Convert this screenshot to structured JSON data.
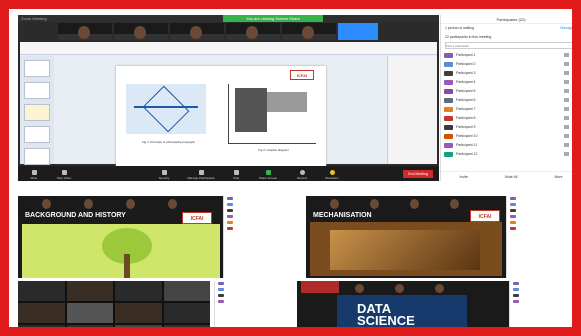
{
  "main_window": {
    "title": "Zoom Meeting",
    "share_banner": "You are viewing Screen Share",
    "participants_panel": {
      "header": "Participants (22)",
      "waiting_label": "1 person is waiting",
      "manage_label": "Manage",
      "in_meeting_label": "22 participants in this meeting",
      "find_placeholder": "Find a participant",
      "participants": [
        {
          "name": "Participant 1",
          "color": "#7d5fb8"
        },
        {
          "name": "Participant 2",
          "color": "#5c8cd6"
        },
        {
          "name": "Participant 3",
          "color": "#3f3f3f"
        },
        {
          "name": "Participant 4",
          "color": "#9b59b6"
        },
        {
          "name": "Participant 5",
          "color": "#8e44ad"
        },
        {
          "name": "Participant 6",
          "color": "#5d6d7e"
        },
        {
          "name": "Participant 7",
          "color": "#e67e22"
        },
        {
          "name": "Participant 8",
          "color": "#c0392b"
        },
        {
          "name": "Participant 9",
          "color": "#3a3a3a"
        },
        {
          "name": "Participant 10",
          "color": "#d35400"
        },
        {
          "name": "Participant 11",
          "color": "#9b59b6"
        },
        {
          "name": "Participant 12",
          "color": "#16a085"
        }
      ],
      "footer": [
        "Invite",
        "Mute All",
        "More"
      ]
    },
    "controls": {
      "mute": "Mute",
      "stop_video": "Stop Video",
      "security": "Security",
      "participants": "Manage Participants",
      "participant_count": "22",
      "chat": "Chat",
      "share": "Share Screen",
      "record": "Record",
      "reactions": "Reactions",
      "end": "End Meeting"
    },
    "slide": {
      "left_caption": "Fig 1: Principle of photoplethysmograph",
      "right_caption": "Fig 2: Graphic diagram",
      "logo": "ICFAI"
    }
  },
  "tiles": [
    {
      "title": "BACKGROUND AND HISTORY",
      "logo": "ICFAI"
    },
    {
      "title": "MECHANISATION",
      "logo": "ICFAI"
    },
    {
      "title": "DATA SCIENCE"
    }
  ],
  "colors": {
    "border": "#e11b1b",
    "share_green": "#38b24a",
    "end_red": "#cf2a2a",
    "zoom_blue": "#2d8cff"
  }
}
